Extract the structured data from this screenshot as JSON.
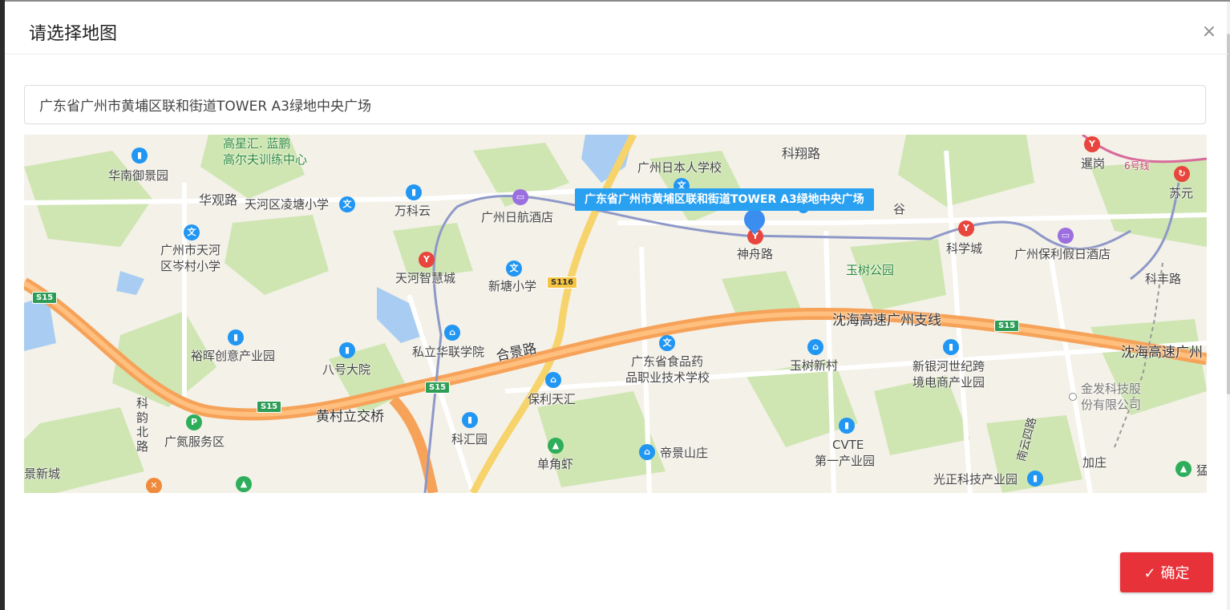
{
  "dialog": {
    "title": "请选择地图",
    "close_symbol": "×"
  },
  "search": {
    "value": "广东省广州市黄埔区联和街道TOWER A3绿地中央广场"
  },
  "map": {
    "callout": "广东省广州市黄埔区联和街道TOWER A3绿地中央广场",
    "poi": {
      "p1": "高星汇. 蓝鹏",
      "p2": "高尔夫训练中心",
      "p3": "华南御景园",
      "p4": "华观路",
      "p5": "天河区凌塘小学",
      "p6": "万科云",
      "p7": "广州日航酒店",
      "p8": "广州日本人学校",
      "p9": "科翔路",
      "p10": "暹岗",
      "p11": "苏元",
      "p12": "6号线",
      "p13": "广州市天河",
      "p14": "区岑村小学",
      "p15": "天河智慧城",
      "p16": "新塘小学",
      "p17": "神舟路",
      "p18": "玉树公园",
      "p19": "科学城",
      "p20": "广州保利假日酒店",
      "p21": "科丰路",
      "p22": "沈海高速广州支线",
      "p23": "沈海高速广州",
      "p24": "裕晖创意产业园",
      "p25": "八号大院",
      "p26": "私立华联学院",
      "p27": "合景路",
      "p28": "广东省食品药",
      "p29": "品职业技术学校",
      "p30": "玉树新村",
      "p31": "新银河世纪跨",
      "p32": "境电商产业园",
      "p33": "金发科技股",
      "p34": "份有限公司",
      "p35": "黄村立交桥",
      "p36": "保利天汇",
      "p37": "科汇园",
      "p38": "科",
      "p39": "韵",
      "p40": "北",
      "p41": "路",
      "p42": "广氮服务区",
      "p43": "单角虾",
      "p44": "帝景山庄",
      "p45": "CVTE",
      "p46": "第一产业园",
      "p47": "南云四路",
      "p48": "加庄",
      "p49": "光正科技产业园",
      "p50": "景新城",
      "p51": "猛",
      "p52": "谷",
      "p53": "科学城"
    },
    "shields": {
      "s15a": "S15",
      "s15b": "S15",
      "s15c": "S15",
      "s15d": "S15",
      "s116": "S116"
    }
  },
  "footer": {
    "confirm_label": "确定",
    "confirm_icon": "✓"
  },
  "colors": {
    "confirm": "#e8323a",
    "callout": "#2aa0f0",
    "marker": "#3b8df0"
  }
}
